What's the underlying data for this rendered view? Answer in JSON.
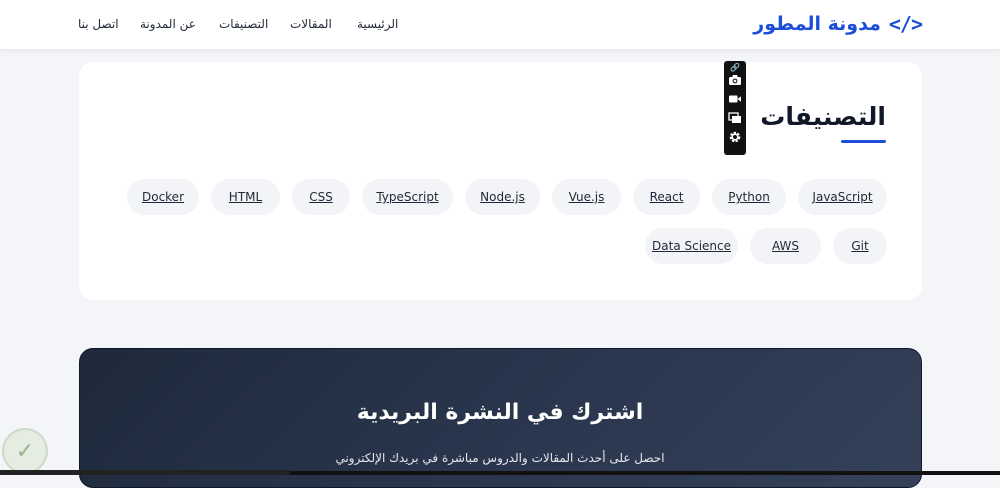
{
  "header": {
    "logo_icon": "</>",
    "logo_text": "مدونة المطور",
    "nav": {
      "home": "الرئيسية",
      "articles": "المقالات",
      "categories": "التصنيفات",
      "about": "عن المدونة",
      "contact": "اتصل بنا"
    }
  },
  "categories": {
    "title": "التصنيفات",
    "tags": [
      "JavaScript",
      "Python",
      "React",
      "Vue.js",
      "Node.js",
      "TypeScript",
      "CSS",
      "HTML",
      "Docker",
      "Git",
      "AWS",
      "Data Science"
    ]
  },
  "toolbar": {
    "icons": [
      "link-icon",
      "camera-icon",
      "video-icon",
      "windows-icon",
      "gear-icon"
    ]
  },
  "newsletter": {
    "title": "اشترك في النشرة البريدية",
    "subtitle": "احصل على أحدث المقالات والدروس مباشرة في بريدك الإلكتروني"
  },
  "colors": {
    "accent": "#1d4ed8",
    "background": "#f3f5f9",
    "card": "#ffffff",
    "newsletter_bg": "#1e293b"
  }
}
